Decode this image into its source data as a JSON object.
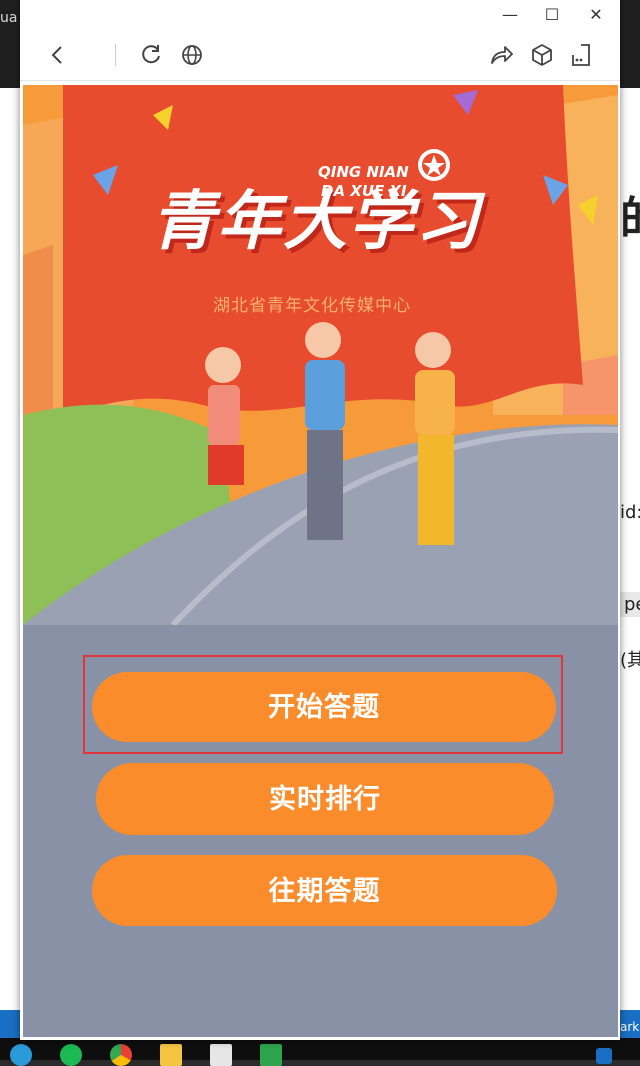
{
  "background_page": {
    "fragments": [
      "ua",
      "的",
      "id:",
      "pe",
      "(其",
      "ark"
    ]
  },
  "window": {
    "controls": {
      "minimize": "—",
      "maximize": "☐",
      "close": "✕"
    }
  },
  "poster": {
    "title": "青年大学习",
    "pinyin_line1": "QING NIAN",
    "pinyin_line2": "DA XUE XI",
    "subtitle": "湖北省青年文化传媒中心"
  },
  "buttons": {
    "start_quiz": "开始答题",
    "realtime_ranking": "实时排行",
    "past_quizzes": "往期答题"
  },
  "colors": {
    "accent_orange": "#fb8c2c",
    "banner_red": "#e84c2f",
    "road_gray": "#8891a6",
    "highlight_red": "#e0353a"
  }
}
